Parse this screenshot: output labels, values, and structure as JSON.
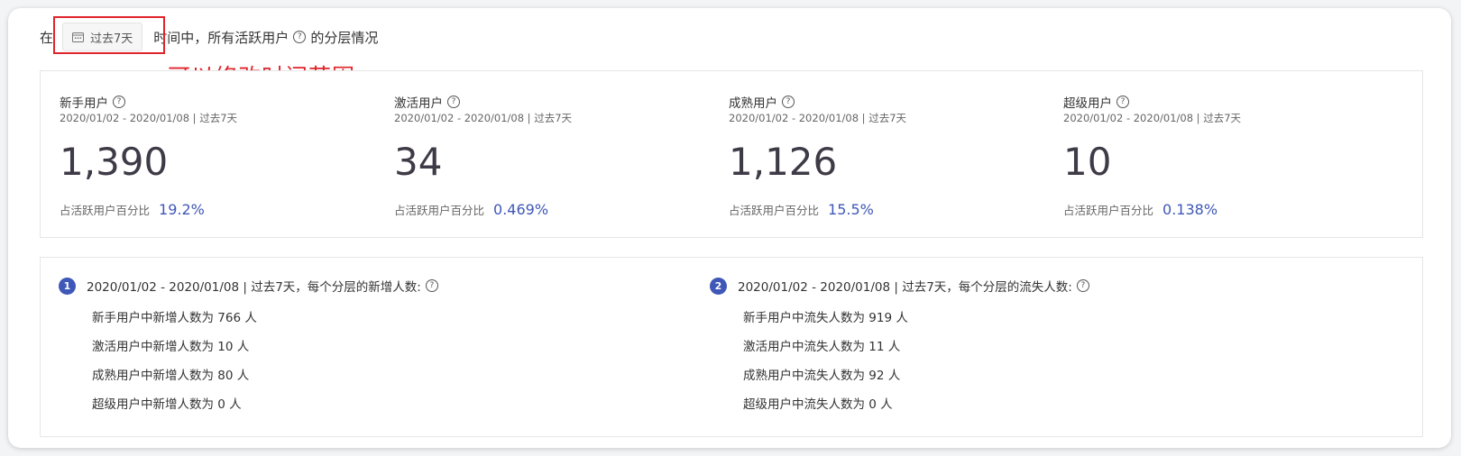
{
  "headline": {
    "prefix": "在",
    "range_button_label": "过去7天",
    "middle": "时间中，所有活跃用户",
    "suffix": "的分层情况",
    "help_icon": "?"
  },
  "annotation": {
    "note": "可以修改时间范围",
    "color": "#e0242b"
  },
  "metrics": [
    {
      "name": "新手用户",
      "range": "2020/01/02 - 2020/01/08 | 过去7天",
      "value": "1,390",
      "pct_label": "占活跃用户百分比",
      "pct": "19.2%"
    },
    {
      "name": "激活用户",
      "range": "2020/01/02 - 2020/01/08 | 过去7天",
      "value": "34",
      "pct_label": "占活跃用户百分比",
      "pct": "0.469%"
    },
    {
      "name": "成熟用户",
      "range": "2020/01/02 - 2020/01/08 | 过去7天",
      "value": "1,126",
      "pct_label": "占活跃用户百分比",
      "pct": "15.5%"
    },
    {
      "name": "超级用户",
      "range": "2020/01/02 - 2020/01/08 | 过去7天",
      "value": "10",
      "pct_label": "占活跃用户百分比",
      "pct": "0.138%"
    }
  ],
  "details": [
    {
      "badge": "1",
      "title": "2020/01/02 - 2020/01/08 | 过去7天，每个分层的新增人数:",
      "items": [
        "新手用户中新增人数为 766 人",
        "激活用户中新增人数为 10 人",
        "成熟用户中新增人数为 80 人",
        "超级用户中新增人数为 0 人"
      ]
    },
    {
      "badge": "2",
      "title": "2020/01/02 - 2020/01/08 | 过去7天，每个分层的流失人数:",
      "items": [
        "新手用户中流失人数为 919 人",
        "激活用户中流失人数为 11 人",
        "成熟用户中流失人数为 92 人",
        "超级用户中流失人数为 0 人"
      ]
    }
  ],
  "colors": {
    "accent": "#3f57b7",
    "value_text": "#3e3a46",
    "annotation": "#e0242b"
  }
}
